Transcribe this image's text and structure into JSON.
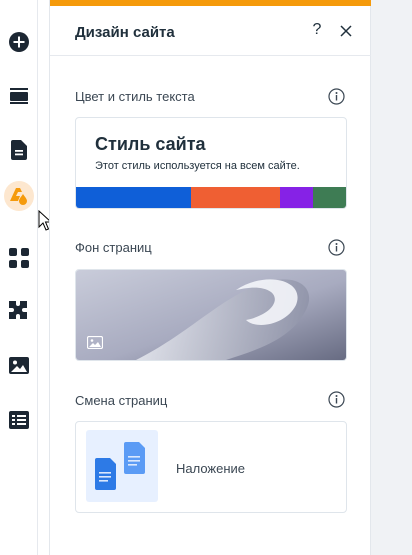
{
  "panel": {
    "title": "Дизайн сайта",
    "help_label": "?",
    "accent_color": "#f59a0b"
  },
  "sidebar": {
    "items": [
      {
        "name": "add",
        "icon": "add-circle-icon"
      },
      {
        "name": "menus",
        "icon": "menus-icon"
      },
      {
        "name": "pages",
        "icon": "pages-icon"
      },
      {
        "name": "site-design",
        "icon": "paint-drop-icon",
        "active": true
      },
      {
        "name": "apps",
        "icon": "apps-grid-icon"
      },
      {
        "name": "business",
        "icon": "puzzle-icon"
      },
      {
        "name": "media",
        "icon": "image-icon"
      },
      {
        "name": "cms",
        "icon": "table-icon"
      }
    ]
  },
  "sections": {
    "text_style": {
      "label": "Цвет и стиль текста",
      "preview_title": "Стиль сайта",
      "preview_subtitle": "Этот стиль используется на всем сайте.",
      "palette": [
        "#0f5fd8",
        "#ef5f33",
        "#8622e6",
        "#3e7c54"
      ]
    },
    "background": {
      "label": "Фон страниц"
    },
    "transitions": {
      "label": "Смена страниц",
      "value": "Наложение"
    }
  }
}
